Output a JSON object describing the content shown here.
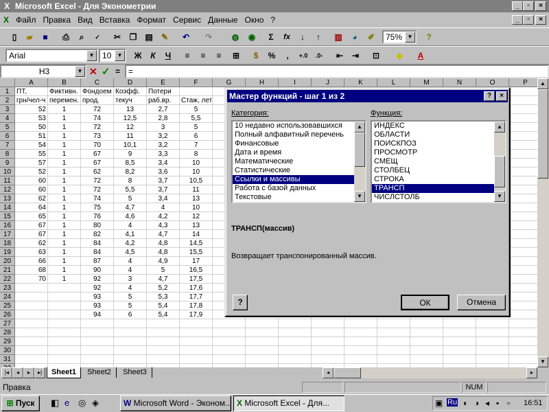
{
  "window": {
    "title": "Microsoft Excel - Для Эконометрии",
    "app_icon": "excel-icon"
  },
  "menu": [
    "Файл",
    "Правка",
    "Вид",
    "Вставка",
    "Формат",
    "Сервис",
    "Данные",
    "Окно",
    "?"
  ],
  "toolbar": {
    "zoom": "75%",
    "font": "Arial",
    "font_size": "10",
    "bold": "Ж",
    "italic": "К",
    "underline": "Ч",
    "percent": "%",
    "comma": ",",
    "sum": "Σ",
    "fx": "fx"
  },
  "formula_bar": {
    "name_box": "H3",
    "equals": "="
  },
  "columns": [
    "A",
    "B",
    "C",
    "D",
    "E",
    "F",
    "G",
    "H",
    "I",
    "J",
    "K",
    "L",
    "M",
    "N",
    "O",
    "P"
  ],
  "rows": [
    "1",
    "2",
    "3",
    "4",
    "5",
    "6",
    "7",
    "8",
    "9",
    "10",
    "11",
    "12",
    "13",
    "14",
    "15",
    "16",
    "17",
    "18",
    "19",
    "20",
    "21",
    "22",
    "23",
    "24",
    "25",
    "26",
    "27",
    "28",
    "29",
    "30",
    "31",
    "32"
  ],
  "sheet": {
    "header1": [
      "ПТ,",
      "Фиктивн.",
      "Фондоем",
      "Коэфф.",
      "Потери",
      ""
    ],
    "header2": [
      "грн/чел-ч",
      "перемен.",
      "прод.",
      "текуч",
      "раб.вр.",
      "Стаж, лет"
    ],
    "data": [
      [
        "52",
        "1",
        "72",
        "13",
        "2,7",
        "5"
      ],
      [
        "53",
        "1",
        "74",
        "12,5",
        "2,8",
        "5,5"
      ],
      [
        "50",
        "1",
        "72",
        "12",
        "3",
        "5"
      ],
      [
        "51",
        "1",
        "73",
        "11",
        "3,2",
        "6"
      ],
      [
        "54",
        "1",
        "70",
        "10,1",
        "3,2",
        "7"
      ],
      [
        "55",
        "1",
        "67",
        "9",
        "3,3",
        "8"
      ],
      [
        "57",
        "1",
        "67",
        "8,5",
        "3,4",
        "10"
      ],
      [
        "52",
        "1",
        "62",
        "8,2",
        "3,6",
        "10"
      ],
      [
        "60",
        "1",
        "72",
        "8",
        "3,7",
        "10,5"
      ],
      [
        "60",
        "1",
        "72",
        "5,5",
        "3,7",
        "11"
      ],
      [
        "62",
        "1",
        "74",
        "5",
        "3,4",
        "13"
      ],
      [
        "64",
        "1",
        "75",
        "4,7",
        "4",
        "10"
      ],
      [
        "65",
        "1",
        "76",
        "4,6",
        "4,2",
        "12"
      ],
      [
        "67",
        "1",
        "80",
        "4",
        "4,3",
        "13"
      ],
      [
        "67",
        "1",
        "82",
        "4,1",
        "4,7",
        "14"
      ],
      [
        "62",
        "1",
        "84",
        "4,2",
        "4,8",
        "14,5"
      ],
      [
        "63",
        "1",
        "84",
        "4,5",
        "4,8",
        "15,5"
      ],
      [
        "66",
        "1",
        "87",
        "4",
        "4,9",
        "17"
      ],
      [
        "68",
        "1",
        "90",
        "4",
        "5",
        "16,5"
      ],
      [
        "70",
        "1",
        "92",
        "3",
        "4,7",
        "17,5"
      ],
      [
        "",
        "",
        "92",
        "4",
        "5,2",
        "17,6"
      ],
      [
        "",
        "",
        "93",
        "5",
        "5,3",
        "17,7"
      ],
      [
        "",
        "",
        "93",
        "5",
        "5,4",
        "17,8"
      ],
      [
        "",
        "",
        "94",
        "6",
        "5,4",
        "17,9"
      ]
    ]
  },
  "tabs": [
    "Sheet1",
    "Sheet2",
    "Sheet3"
  ],
  "status": {
    "left": "Правка",
    "num": "NUM"
  },
  "taskbar": {
    "start": "Пуск",
    "tasks": [
      "Microsoft Word - Эконом...",
      "Microsoft Excel - Для..."
    ],
    "lang": "Ru",
    "time": "16:51"
  },
  "dialog": {
    "title": "Мастер функций - шаг 1 из 2",
    "help_btn": "?",
    "close_btn": "×",
    "category_label": "Категория:",
    "function_label": "Функция:",
    "categories": [
      "10 недавно использовавшихся",
      "Полный алфавитный перечень",
      "Финансовые",
      "Дата и время",
      "Математические",
      "Статистические",
      "Ссылки и массивы",
      "Работа с базой данных",
      "Текстовые"
    ],
    "selected_category": 6,
    "functions": [
      "ИНДЕКС",
      "ОБЛАСТИ",
      "ПОИСКПОЗ",
      "ПРОСМОТР",
      "СМЕЩ",
      "СТОЛБЕЦ",
      "СТРОКА",
      "ТРАНСП",
      "ЧИСЛСТОЛБ"
    ],
    "selected_function": 7,
    "signature": "ТРАНСП(массив)",
    "description": "Возвращает транспонированный массив.",
    "ok": "ОК",
    "cancel": "Отмена"
  }
}
